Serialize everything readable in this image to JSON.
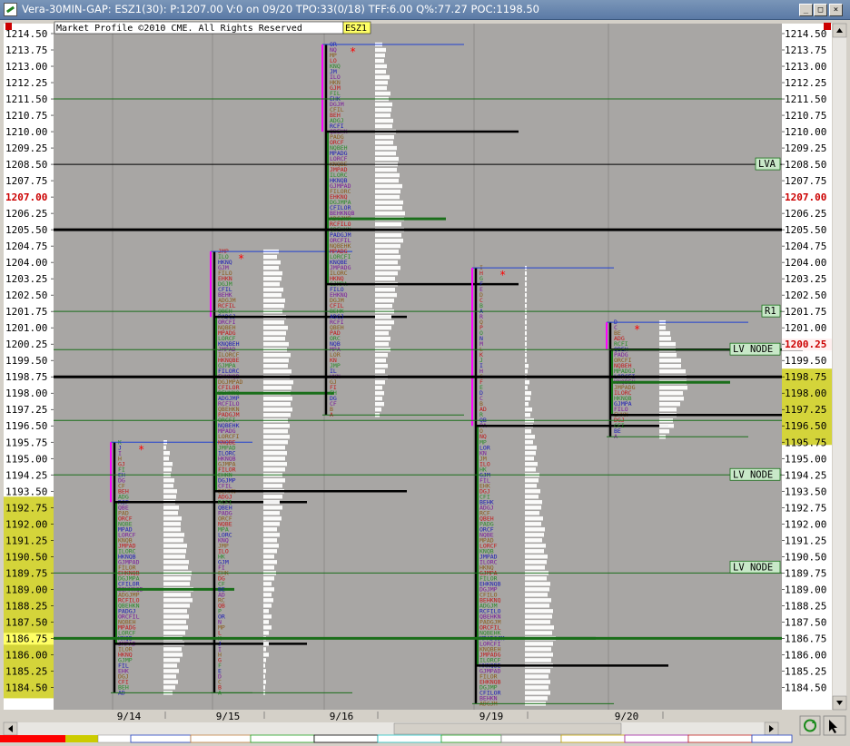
{
  "window": {
    "title": "Vera-30MIN-GAP: ESZ1(30): P:1207.00 V:0 on 09/20 TPO:33(0/18) TFF:6.00 Q%:77.27 POC:1198.50",
    "minimize_glyph": "_",
    "maximize_glyph": "□",
    "close_glyph": "×"
  },
  "chart_data": {
    "type": "market-profile",
    "copyright": "Market Profile ©2010 CME. All Rights Reserved",
    "symbol": "ESZ1",
    "y_range": [
      1183.75,
      1214.75
    ],
    "tick_step": 0.75,
    "price_labels": [
      "1214.50",
      "1213.75",
      "1213.00",
      "1212.25",
      "1211.50",
      "1210.75",
      "1210.00",
      "1209.25",
      "1208.50",
      "1207.75",
      "1207.00",
      "1206.25",
      "1205.50",
      "1204.75",
      "1204.00",
      "1203.25",
      "1202.50",
      "1201.75",
      "1201.00",
      "1200.25",
      "1199.50",
      "1198.75",
      "1198.00",
      "1197.25",
      "1196.50",
      "1195.75",
      "1195.00",
      "1194.25",
      "1193.50",
      "1192.75",
      "1192.00",
      "1191.25",
      "1190.50",
      "1189.75",
      "1189.00",
      "1188.25",
      "1187.50",
      "1186.75",
      "1186.00",
      "1185.25",
      "1184.50"
    ],
    "current_price": "1207.00",
    "left_highlight_label": "1186.75",
    "right_highlight_label": "1200.25",
    "dates": [
      "9/14",
      "9/15",
      "9/16",
      "9/19",
      "9/20"
    ],
    "annotations": [
      {
        "text": "LVA",
        "price": 1208.5
      },
      {
        "text": "R1",
        "price": 1201.75
      },
      {
        "text": "LV NODE",
        "price": 1200.0
      },
      {
        "text": "LV NODE",
        "price": 1194.25
      },
      {
        "text": "LV NODE",
        "price": 1190.0
      }
    ],
    "profiles": [
      {
        "date": "9/14",
        "low": 1184.25,
        "high": 1195.75,
        "poc": 1189.0,
        "va_low": 1186.5,
        "va_high": 1193.0
      },
      {
        "date": "9/15",
        "low": 1184.25,
        "high": 1204.5,
        "poc": 1198.0,
        "va_low": 1193.5,
        "va_high": 1201.5
      },
      {
        "date": "9/16",
        "low": 1197.0,
        "high": 1214.0,
        "poc": 1206.0,
        "va_low": 1203.0,
        "va_high": 1210.0
      },
      {
        "date": "9/19",
        "low": 1183.75,
        "high": 1203.75,
        "poc": 1186.75,
        "va_low": 1185.5,
        "va_high": 1196.5
      },
      {
        "date": "9/20",
        "low": 1196.0,
        "high": 1201.25,
        "poc": 1198.5,
        "va_low": 1197.0,
        "va_high": 1200.0
      }
    ],
    "levels": [
      {
        "price": 1211.5,
        "color": "#1a6e1a",
        "width": 1
      },
      {
        "price": 1208.5,
        "color": "#000000",
        "width": 1
      },
      {
        "price": 1201.75,
        "color": "#1a6e1a",
        "width": 1
      },
      {
        "price": 1200.0,
        "color": "#1a6e1a",
        "width": 1
      },
      {
        "price": 1196.75,
        "color": "#1a6e1a",
        "width": 1
      },
      {
        "price": 1194.25,
        "color": "#1a6e1a",
        "width": 1
      },
      {
        "price": 1189.75,
        "color": "#1a6e1a",
        "width": 1
      },
      {
        "price": 1186.75,
        "color": "#1a6e1a",
        "width": 3
      },
      {
        "price": 1198.75,
        "color": "#000000",
        "width": 3
      },
      {
        "price": 1205.5,
        "color": "#000000",
        "width": 3
      }
    ]
  },
  "colors": {
    "plot_bg": "#a8a6a4",
    "axis_bg": "#ffffff",
    "highlight_yellow": "#d4d43a",
    "current_price": "#cc0000",
    "tpo_blue": "#1a1ab4",
    "tpo_green": "#2a8a2a",
    "tpo_red": "#c01818",
    "tpo_brown": "#8a5a1a",
    "tpo_purple": "#7a1a9a",
    "magenta": "#ff00ff"
  },
  "status_bar": {
    "refresh_icon": "refresh-icon",
    "settings_icon": "cursor-icon"
  }
}
